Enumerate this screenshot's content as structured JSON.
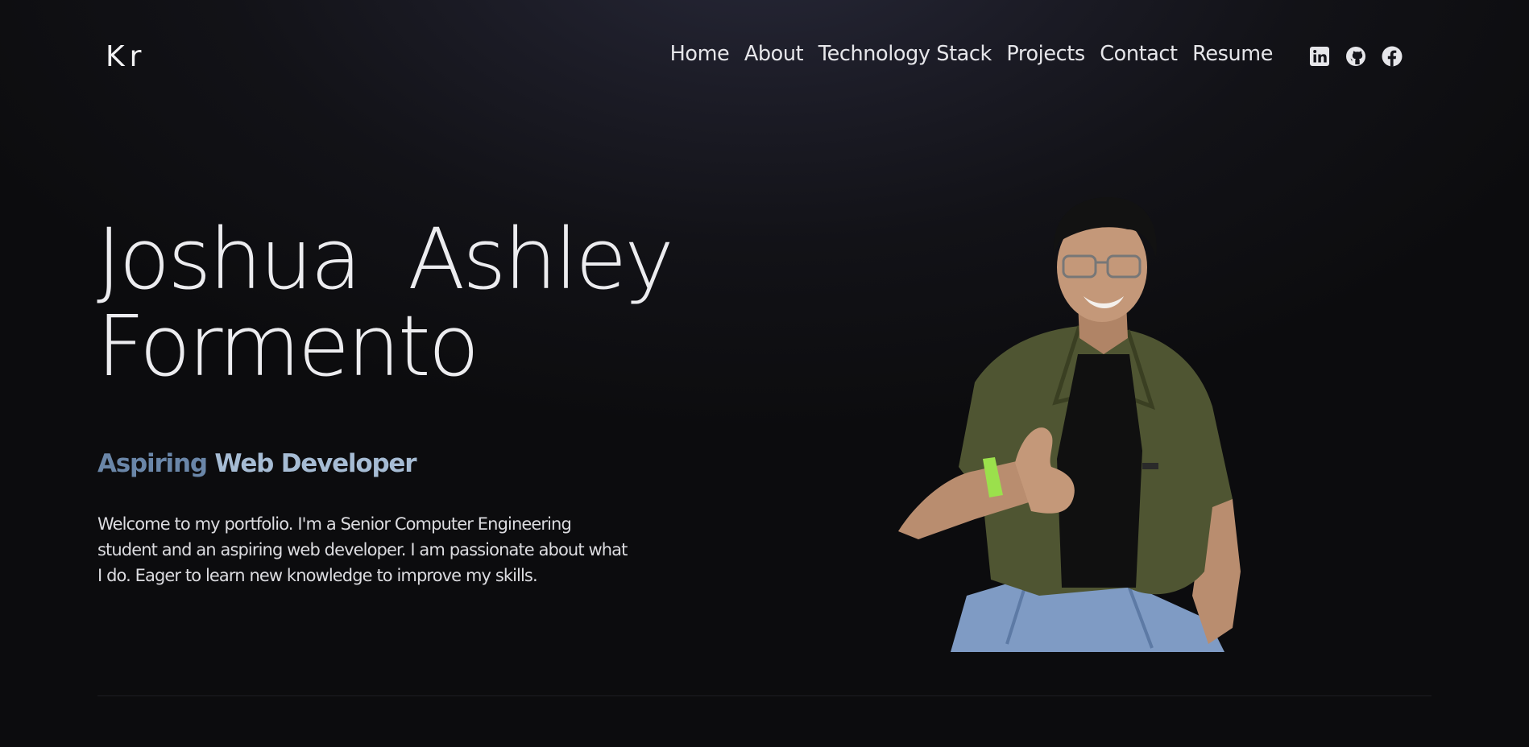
{
  "header": {
    "logo_text": "Kr",
    "nav": [
      "Home",
      "About",
      "Technology Stack",
      "Projects",
      "Contact",
      "Resume"
    ],
    "social_icons": [
      "linkedin-icon",
      "github-icon",
      "facebook-icon"
    ]
  },
  "hero": {
    "name_line1": "Joshua  Ashley",
    "name_line2": "Formento",
    "subtitle_part1": "Aspiring",
    "subtitle_part2": " Web Developer",
    "intro": "Welcome to my portfolio. I'm a Senior Computer Engineering student and an aspiring web developer. I am passionate about what I do. Eager to learn new knowledge to improve my skills."
  },
  "colors": {
    "background": "#0c0c0e",
    "subtitle_muted": "#6a86a8",
    "subtitle_light": "#a6bcd4"
  }
}
